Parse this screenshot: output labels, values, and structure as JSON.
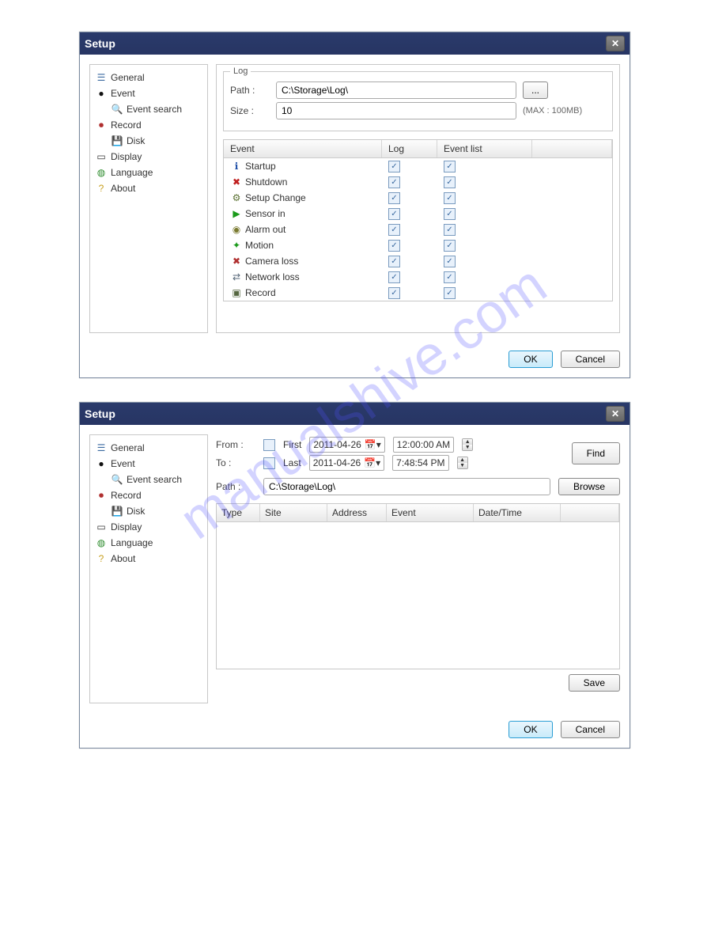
{
  "watermark": "manualshive.com",
  "dialog1": {
    "title": "Setup",
    "log": {
      "group_title": "Log",
      "path_label": "Path :",
      "path_value": "C:\\Storage\\Log\\",
      "browse_label": "...",
      "size_label": "Size :",
      "size_value": "10",
      "max_hint": "(MAX : 100MB)"
    },
    "columns": {
      "event": "Event",
      "log": "Log",
      "event_list": "Event list"
    },
    "events": [
      {
        "icon": "info-icon",
        "icon_char": "ℹ",
        "icon_color": "#1e4fa8",
        "label": "Startup",
        "log": true,
        "event_list": true
      },
      {
        "icon": "error-icon",
        "icon_char": "✖",
        "icon_color": "#c02020",
        "label": "Shutdown",
        "log": true,
        "event_list": true
      },
      {
        "icon": "setup-icon",
        "icon_char": "⚙",
        "icon_color": "#5a7030",
        "label": "Setup Change",
        "log": true,
        "event_list": true
      },
      {
        "icon": "sensor-icon",
        "icon_char": "▶",
        "icon_color": "#1a9a1a",
        "label": "Sensor in",
        "log": true,
        "event_list": true
      },
      {
        "icon": "alarm-icon",
        "icon_char": "◉",
        "icon_color": "#7a7a30",
        "label": "Alarm out",
        "log": true,
        "event_list": true
      },
      {
        "icon": "motion-icon",
        "icon_char": "✦",
        "icon_color": "#1a9a1a",
        "label": "Motion",
        "log": true,
        "event_list": true
      },
      {
        "icon": "camera-icon",
        "icon_char": "✖",
        "icon_color": "#b03030",
        "label": "Camera loss",
        "log": true,
        "event_list": true
      },
      {
        "icon": "network-icon",
        "icon_char": "⇄",
        "icon_color": "#556677",
        "label": "Network loss",
        "log": true,
        "event_list": true
      },
      {
        "icon": "record-icon",
        "icon_char": "▣",
        "icon_color": "#556640",
        "label": "Record",
        "log": true,
        "event_list": true
      }
    ],
    "footer": {
      "ok": "OK",
      "cancel": "Cancel"
    }
  },
  "sidebar": {
    "items": [
      {
        "key": "general",
        "label": "General",
        "indent": false,
        "icon_char": "☰",
        "icon_color": "#3b6aa0"
      },
      {
        "key": "event",
        "label": "Event",
        "indent": false,
        "icon_char": "●",
        "icon_color": "#111"
      },
      {
        "key": "eventsearch",
        "label": "Event search",
        "indent": true,
        "icon_char": "🔍",
        "icon_color": "#8a4a00"
      },
      {
        "key": "record",
        "label": "Record",
        "indent": false,
        "icon_char": "⏺",
        "icon_color": "#b03030"
      },
      {
        "key": "disk",
        "label": "Disk",
        "indent": true,
        "icon_char": "💾",
        "icon_color": "#333"
      },
      {
        "key": "display",
        "label": "Display",
        "indent": false,
        "icon_char": "▭",
        "icon_color": "#333"
      },
      {
        "key": "language",
        "label": "Language",
        "indent": false,
        "icon_char": "◍",
        "icon_color": "#2a8a2a"
      },
      {
        "key": "about",
        "label": "About",
        "indent": false,
        "icon_char": "?",
        "icon_color": "#c8a020"
      }
    ]
  },
  "dialog2": {
    "title": "Setup",
    "from_label": "From :",
    "to_label": "To :",
    "first_label": "First",
    "last_label": "Last",
    "from_date": "2011-04-26",
    "to_date": "2011-04-26",
    "from_time": "12:00:00 AM",
    "to_time": "7:48:54 PM",
    "find_label": "Find",
    "path_label": "Path :",
    "path_value": "C:\\Storage\\Log\\",
    "browse_label": "Browse",
    "columns": {
      "type": "Type",
      "site": "Site",
      "address": "Address",
      "event": "Event",
      "datetime": "Date/Time"
    },
    "save_label": "Save",
    "footer": {
      "ok": "OK",
      "cancel": "Cancel"
    }
  }
}
